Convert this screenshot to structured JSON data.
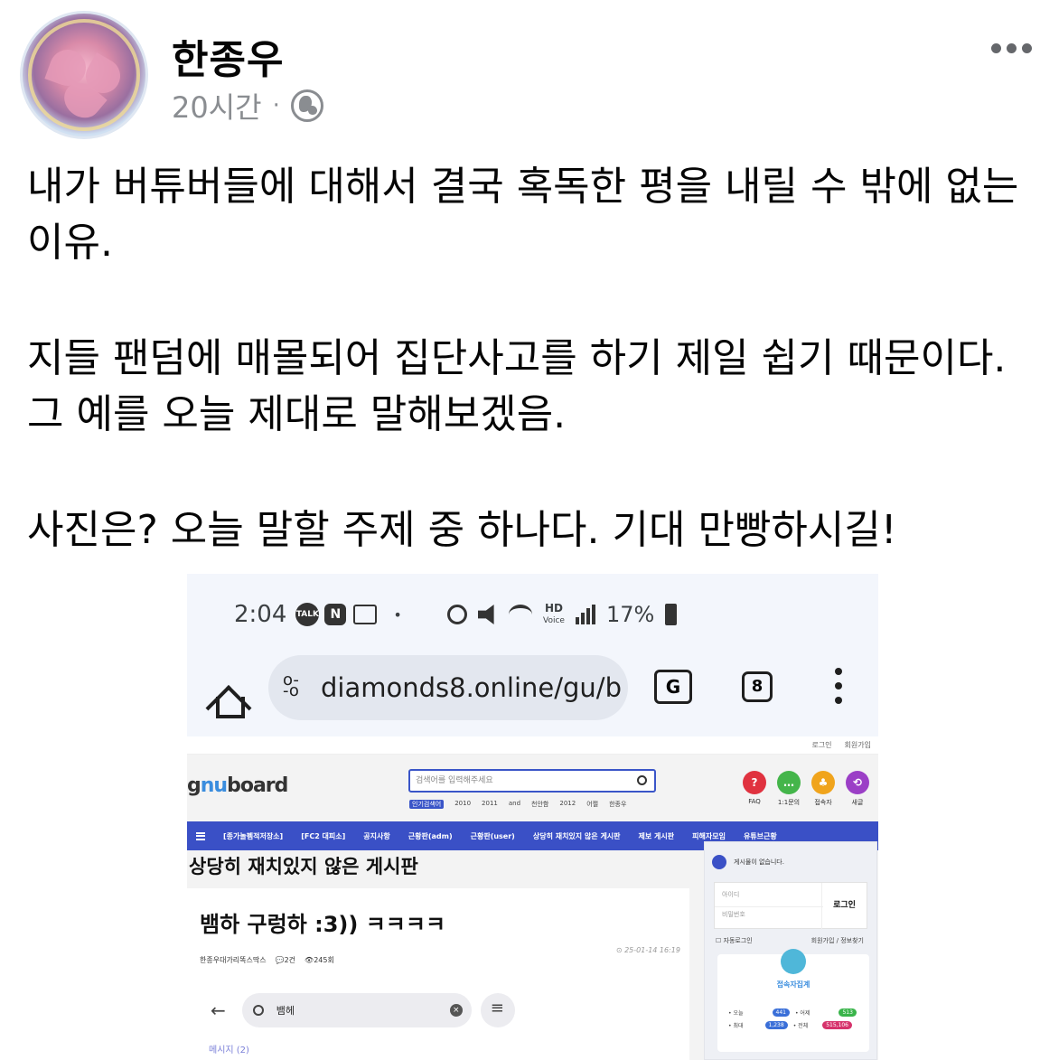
{
  "post": {
    "author": "한종우",
    "time": "20시간",
    "separator": "·",
    "paragraphs": [
      "내가 버튜버들에 대해서 결국 혹독한 평을 내릴 수 밖에 없는 이유.",
      "지들 팬덤에 매몰되어 집단사고를 하기 제일 쉽기 때문이다. 그 예를 오늘 제대로 말해보겠음.",
      "사진은? 오늘 말할 주제 중 하나다. 기대 만빵하시길!"
    ]
  },
  "screenshot": {
    "status": {
      "time": "2:04",
      "talk": "TALK",
      "n": "N",
      "dot": "•",
      "hd": "HD",
      "voice": "Voice",
      "battery": "17%"
    },
    "browser": {
      "url": "diamonds8.online/gu/b",
      "translate": "G",
      "tab_count": "8"
    },
    "site": {
      "top_links": [
        "로그인",
        "회원가입"
      ],
      "logo_a": "g",
      "logo_b": "nu",
      "logo_c": "board",
      "search_placeholder": "검색어를 입력해주세요",
      "popular_label": "인기검색어",
      "popular_words": [
        "2010",
        "2011",
        "and",
        "천안함",
        "2012",
        "어쩔",
        "한종우"
      ],
      "quick": [
        {
          "label": "FAQ",
          "glyph": "?",
          "color": "#e0323f"
        },
        {
          "label": "1:1문의",
          "glyph": "…",
          "color": "#44b54a"
        },
        {
          "label": "접속자",
          "glyph": "♣",
          "color": "#f0a41c"
        },
        {
          "label": "새글",
          "glyph": "⟲",
          "color": "#9b3fc6"
        }
      ],
      "nav": [
        "[종가놀펨적저장소]",
        "[FC2 대피소]",
        "공지사항",
        "근황판(adm)",
        "근황판(user)",
        "상당히 재치있지 않은 게시판",
        "제보 게시판",
        "피해자모임",
        "유튜브근황"
      ],
      "board_title": "상당히 재치있지 않은 게시판",
      "article": {
        "title": "뱀하 구렁하 :3)) ㅋㅋㅋㅋ",
        "author": "한종우대가리똑스딱스",
        "comments": "2건",
        "views": "245회",
        "date": "25-01-14 16:19"
      },
      "inner_search": {
        "query": "뱀헤",
        "tab": "메시지 (2)"
      },
      "sidebar": {
        "notice": "게시물이 없습니다.",
        "id_label": "아이디",
        "pw_label": "비밀번호",
        "login_button": "로그인",
        "auto_login": "자동로그인",
        "join": "회원가입",
        "find": "정보찾기",
        "visitors_title": "접속자집계",
        "today_label": "오늘",
        "today": "441",
        "yesterday_label": "어제",
        "yesterday": "513",
        "max_label": "최대",
        "max": "1,238",
        "total_label": "전체",
        "total": "515,106"
      }
    }
  }
}
